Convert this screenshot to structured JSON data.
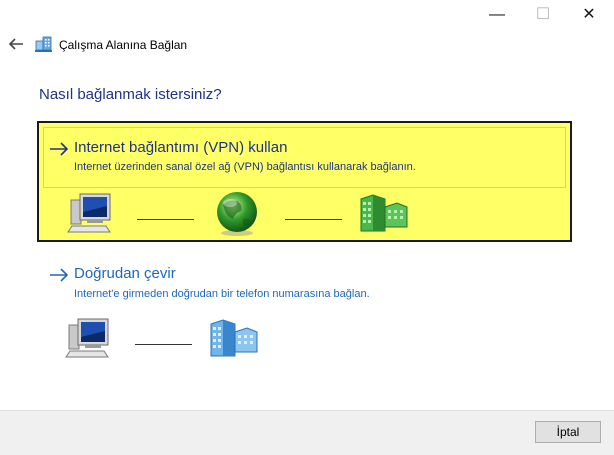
{
  "window": {
    "title": "Çalışma Alanına Bağlan",
    "minimize_glyph": "—",
    "maximize_glyph": "☐",
    "close_glyph": "✕"
  },
  "prompt": "Nasıl bağlanmak istersiniz?",
  "options": [
    {
      "title": "Internet bağlantımı (VPN) kullan",
      "description": "Internet üzerinden sanal özel ağ (VPN) bağlantısı kullanarak bağlanın.",
      "highlighted": true,
      "diagram": [
        "computer-icon",
        "globe-icon",
        "office-building-icon"
      ]
    },
    {
      "title": "Doğrudan çevir",
      "description": "Internet'e girmeden doğrudan bir telefon numarasına bağlan.",
      "highlighted": false,
      "diagram": [
        "computer-icon",
        "office-building-icon"
      ]
    }
  ],
  "footer": {
    "cancel_label": "İptal"
  },
  "colors": {
    "highlight": "#ffff66",
    "heading_blue": "#1e3287",
    "link_blue": "#1f68b8",
    "footer_bg": "#f0f0f0"
  }
}
